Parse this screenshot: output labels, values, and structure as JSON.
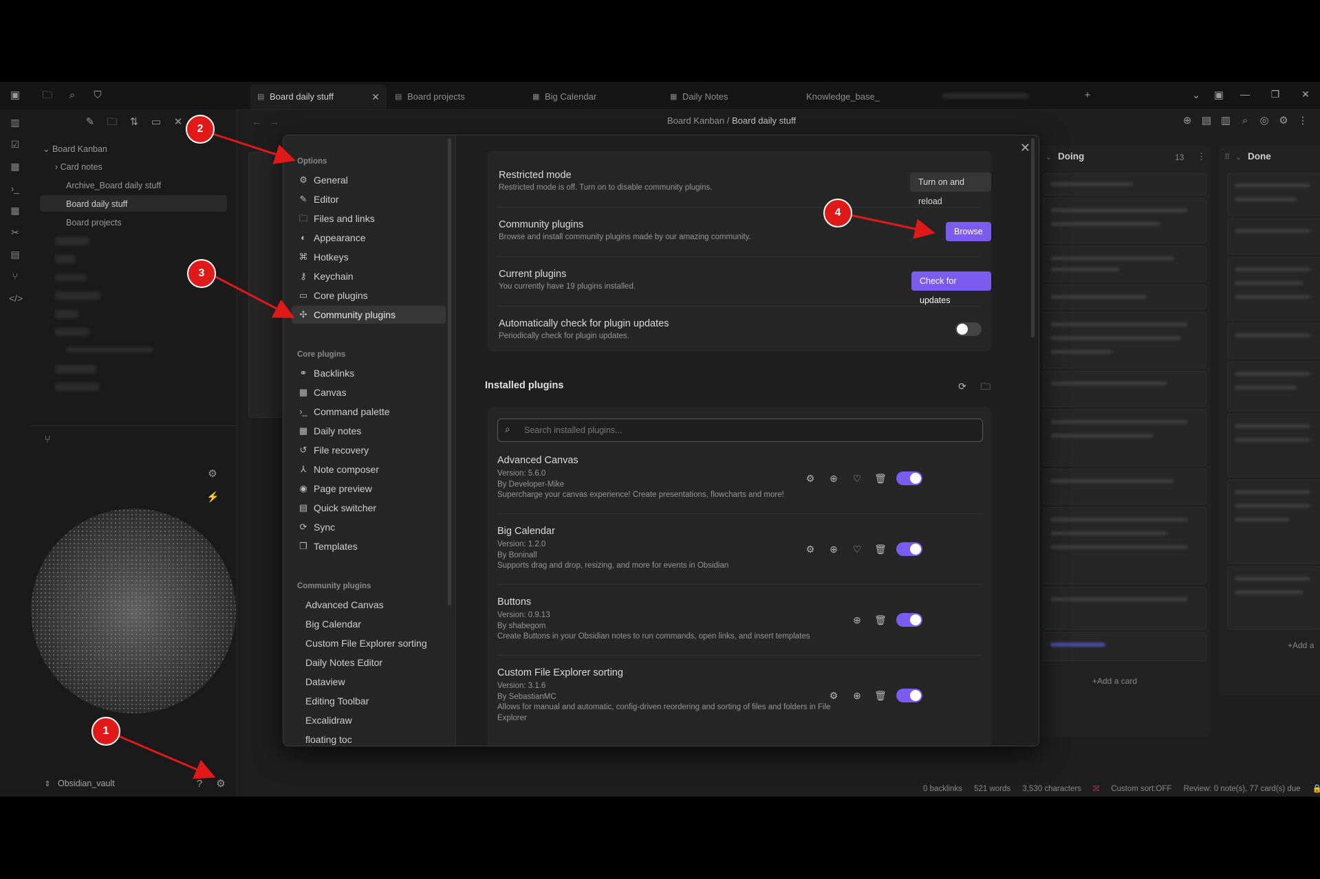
{
  "tabs": [
    {
      "label": "Board daily stuff",
      "active": true
    },
    {
      "label": "Board projects"
    },
    {
      "label": "Big Calendar"
    },
    {
      "label": "Daily Notes"
    },
    {
      "label": "Knowledge_base_"
    }
  ],
  "breadcrumb": {
    "parent": "Board Kanban",
    "sep": "/",
    "current": "Board daily stuff"
  },
  "file_tree": {
    "root": "Board Kanban",
    "items": [
      "Card notes",
      "Archive_Board daily stuff",
      "Board daily stuff",
      "Board projects"
    ]
  },
  "vault_name": "Obsidian_vault",
  "kanban": {
    "columns": [
      {
        "title": "Doing",
        "count": "13"
      },
      {
        "title": "Done"
      }
    ],
    "add_card": "+Add a card",
    "add_card_short": "+Add a"
  },
  "status_bar": {
    "backlinks": "0 backlinks",
    "words": "521 words",
    "characters": "3,530 characters",
    "sort": "Custom sort:OFF",
    "review": "Review: 0 note(s), 77 card(s) due"
  },
  "settings": {
    "nav": {
      "options_header": "Options",
      "options": [
        "General",
        "Editor",
        "Files and links",
        "Appearance",
        "Hotkeys",
        "Keychain",
        "Core plugins",
        "Community plugins"
      ],
      "core_header": "Core plugins",
      "core": [
        "Backlinks",
        "Canvas",
        "Command palette",
        "Daily notes",
        "File recovery",
        "Note composer",
        "Page preview",
        "Quick switcher",
        "Sync",
        "Templates"
      ],
      "community_header": "Community plugins",
      "community": [
        "Advanced Canvas",
        "Big Calendar",
        "Custom File Explorer sorting",
        "Daily Notes Editor",
        "Dataview",
        "Editing Toolbar",
        "Excalidraw",
        "floating toc"
      ]
    },
    "restricted": {
      "name": "Restricted mode",
      "desc": "Restricted mode is off. Turn on to disable community plugins.",
      "button": "Turn on and reload"
    },
    "community": {
      "name": "Community plugins",
      "desc": "Browse and install community plugins made by our amazing community.",
      "button": "Browse"
    },
    "current": {
      "name": "Current plugins",
      "desc": "You currently have 19 plugins installed.",
      "button": "Check for updates"
    },
    "auto_check": {
      "name": "Automatically check for plugin updates",
      "desc": "Periodically check for plugin updates.",
      "enabled": false
    },
    "installed_header": "Installed plugins",
    "search_placeholder": "Search installed plugins...",
    "plugins": [
      {
        "name": "Advanced Canvas",
        "version": "Version: 5.6.0",
        "author": "By Developer-Mike",
        "desc": "Supercharge your canvas experience! Create presentations, flowcharts and more!",
        "enabled": true
      },
      {
        "name": "Big Calendar",
        "version": "Version: 1.2.0",
        "author": "By Boninall",
        "desc": "Supports drag and drop, resizing, and more for events in Obsidian",
        "enabled": true
      },
      {
        "name": "Buttons",
        "version": "Version: 0.9.13",
        "author": "By shabegom",
        "desc": "Create Buttons in your Obsidian notes to run commands, open links, and insert templates",
        "enabled": true
      },
      {
        "name": "Custom File Explorer sorting",
        "version": "Version: 3.1.6",
        "author": "By SebastianMC",
        "desc": "Allows for manual and automatic, config-driven reordering and sorting of files and folders in File Explorer",
        "enabled": true
      }
    ]
  },
  "annotations": [
    "1",
    "2",
    "3",
    "4"
  ],
  "colors": {
    "accent": "#7b5cf0",
    "marker": "#e01919",
    "background": "#1e1e1e"
  }
}
